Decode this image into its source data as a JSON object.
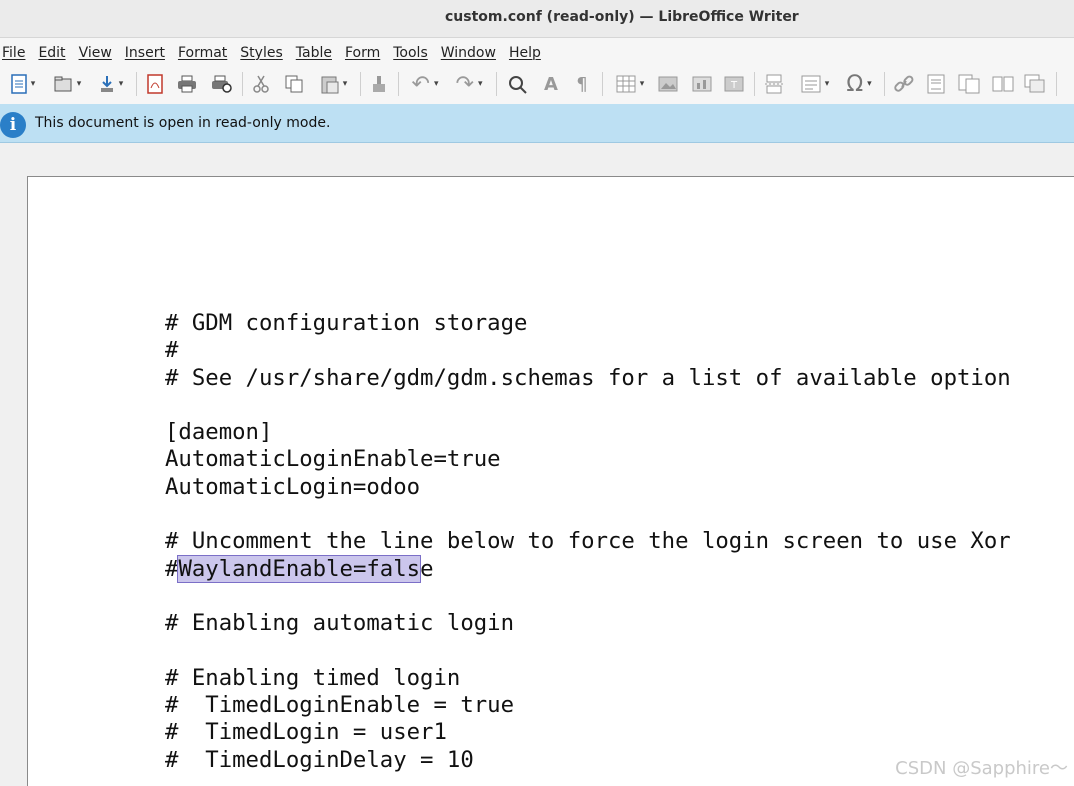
{
  "window": {
    "title": "custom.conf (read-only) — LibreOffice Writer"
  },
  "menu": [
    "File",
    "Edit",
    "View",
    "Insert",
    "Format",
    "Styles",
    "Table",
    "Form",
    "Tools",
    "Window",
    "Help"
  ],
  "toolbar": {
    "icons": [
      "new-document-icon",
      "open-icon",
      "save-icon",
      "export-pdf-icon",
      "print-icon",
      "print-preview-icon",
      "cut-icon",
      "copy-icon",
      "paste-icon",
      "clone-formatting-icon",
      "undo-icon",
      "redo-icon",
      "find-replace-icon",
      "spelling-icon",
      "formatting-marks-icon",
      "insert-table-icon",
      "insert-image-icon",
      "insert-chart-icon",
      "insert-textbox-icon",
      "page-break-icon",
      "insert-field-icon",
      "special-character-icon",
      "hyperlink-icon",
      "footnote-icon",
      "endnote-icon",
      "bookmark-icon",
      "cross-reference-icon"
    ]
  },
  "infobar": {
    "message": "This document is open in read-only mode."
  },
  "document": {
    "lines": [
      "# GDM configuration storage",
      "#",
      "# See /usr/share/gdm/gdm.schemas for a list of available option",
      "",
      "[daemon]",
      "AutomaticLoginEnable=true",
      "AutomaticLogin=odoo",
      "",
      "# Uncomment the line below to force the login screen to use Xor",
      {
        "prefix": "#",
        "selected": "WaylandEnable=fals",
        "suffix": "e"
      },
      "",
      "# Enabling automatic login",
      "",
      "# Enabling timed login",
      "#  TimedLoginEnable = true",
      "#  TimedLogin = user1",
      "#  TimedLoginDelay = 10"
    ]
  },
  "watermark": "CSDN @Sapphire～"
}
